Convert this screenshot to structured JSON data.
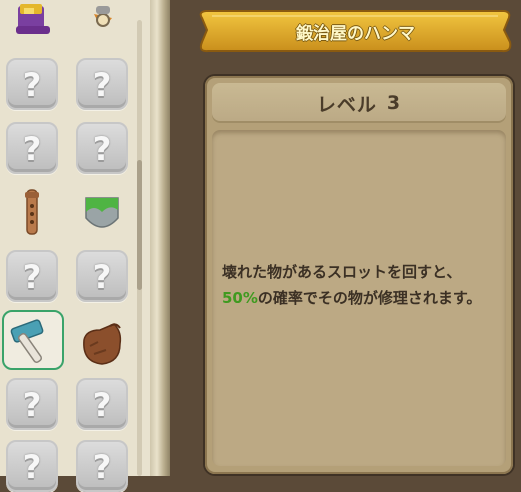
{
  "item_detail": {
    "title": "鍛治屋のハンマ",
    "level_label": "レベル",
    "level_value": "3",
    "description_before": "壊れた物があるスロットを回すと、",
    "description_highlight": "50%",
    "description_after": "の確率でその物が修理されます。",
    "highlight_color": "#3f9a20"
  },
  "inventory": {
    "unknown_glyph": "?",
    "slots": [
      {
        "kind": "item",
        "icon": "purple-crown-icon"
      },
      {
        "kind": "item",
        "icon": "bell-lamp-icon"
      },
      {
        "kind": "unknown"
      },
      {
        "kind": "unknown"
      },
      {
        "kind": "unknown"
      },
      {
        "kind": "unknown"
      },
      {
        "kind": "item",
        "icon": "flute-icon"
      },
      {
        "kind": "item",
        "icon": "green-shield-icon"
      },
      {
        "kind": "unknown"
      },
      {
        "kind": "unknown"
      },
      {
        "kind": "item",
        "icon": "hammer-icon",
        "selected": true
      },
      {
        "kind": "item",
        "icon": "brown-sack-icon"
      },
      {
        "kind": "unknown"
      },
      {
        "kind": "unknown"
      },
      {
        "kind": "unknown"
      },
      {
        "kind": "unknown"
      }
    ]
  }
}
